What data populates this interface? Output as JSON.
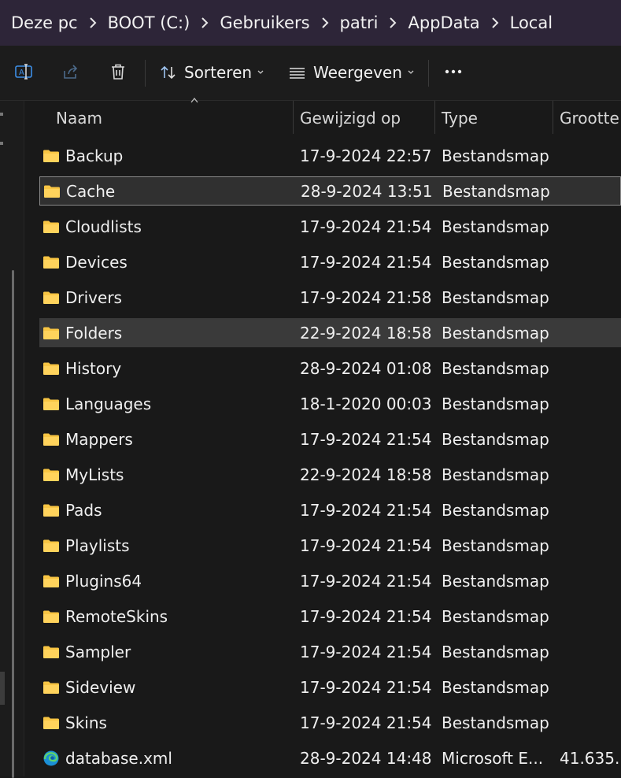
{
  "breadcrumb": [
    "Deze pc",
    "BOOT (C:)",
    "Gebruikers",
    "patri",
    "AppData",
    "Local"
  ],
  "toolbar": {
    "sort_label": "Sorteren",
    "view_label": "Weergeven",
    "more_label": "•••"
  },
  "columns": {
    "name": "Naam",
    "modified": "Gewijzigd op",
    "type": "Type",
    "size": "Grootte"
  },
  "files": [
    {
      "name": "Backup",
      "modified": "17-9-2024 22:57",
      "type": "Bestandsmap",
      "size": "",
      "icon": "folder-icon"
    },
    {
      "name": "Cache",
      "modified": "28-9-2024 13:51",
      "type": "Bestandsmap",
      "size": "",
      "icon": "folder-icon",
      "state": "selected"
    },
    {
      "name": "Cloudlists",
      "modified": "17-9-2024 21:54",
      "type": "Bestandsmap",
      "size": "",
      "icon": "folder-icon"
    },
    {
      "name": "Devices",
      "modified": "17-9-2024 21:54",
      "type": "Bestandsmap",
      "size": "",
      "icon": "folder-icon"
    },
    {
      "name": "Drivers",
      "modified": "17-9-2024 21:58",
      "type": "Bestandsmap",
      "size": "",
      "icon": "folder-icon"
    },
    {
      "name": "Folders",
      "modified": "22-9-2024 18:58",
      "type": "Bestandsmap",
      "size": "",
      "icon": "folder-icon",
      "state": "hover"
    },
    {
      "name": "History",
      "modified": "28-9-2024 01:08",
      "type": "Bestandsmap",
      "size": "",
      "icon": "folder-icon"
    },
    {
      "name": "Languages",
      "modified": "18-1-2020 00:03",
      "type": "Bestandsmap",
      "size": "",
      "icon": "folder-icon"
    },
    {
      "name": "Mappers",
      "modified": "17-9-2024 21:54",
      "type": "Bestandsmap",
      "size": "",
      "icon": "folder-icon"
    },
    {
      "name": "MyLists",
      "modified": "22-9-2024 18:58",
      "type": "Bestandsmap",
      "size": "",
      "icon": "folder-icon"
    },
    {
      "name": "Pads",
      "modified": "17-9-2024 21:54",
      "type": "Bestandsmap",
      "size": "",
      "icon": "folder-icon"
    },
    {
      "name": "Playlists",
      "modified": "17-9-2024 21:54",
      "type": "Bestandsmap",
      "size": "",
      "icon": "folder-icon"
    },
    {
      "name": "Plugins64",
      "modified": "17-9-2024 21:54",
      "type": "Bestandsmap",
      "size": "",
      "icon": "folder-icon"
    },
    {
      "name": "RemoteSkins",
      "modified": "17-9-2024 21:54",
      "type": "Bestandsmap",
      "size": "",
      "icon": "folder-icon"
    },
    {
      "name": "Sampler",
      "modified": "17-9-2024 21:54",
      "type": "Bestandsmap",
      "size": "",
      "icon": "folder-icon"
    },
    {
      "name": "Sideview",
      "modified": "17-9-2024 21:54",
      "type": "Bestandsmap",
      "size": "",
      "icon": "folder-icon"
    },
    {
      "name": "Skins",
      "modified": "17-9-2024 21:54",
      "type": "Bestandsmap",
      "size": "",
      "icon": "folder-icon"
    },
    {
      "name": "database.xml",
      "modified": "28-9-2024 14:48",
      "type": "Microsoft E...",
      "size": "41.635...",
      "icon": "edge-icon"
    }
  ],
  "colors": {
    "breadcrumb_bg": "#2d2538",
    "folder": "#f8c543",
    "selection_border": "#8a8a8a"
  }
}
